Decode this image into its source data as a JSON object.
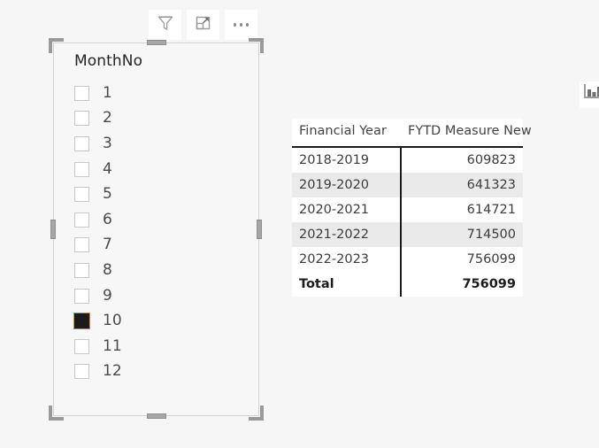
{
  "toolbar": {
    "items": [
      {
        "name": "filter-icon",
        "label": "Filters"
      },
      {
        "name": "focus-mode-icon",
        "label": "Focus mode"
      },
      {
        "name": "more-options-icon",
        "label": "More options"
      }
    ]
  },
  "slicer": {
    "title": "MonthNo",
    "items": [
      {
        "label": "1",
        "checked": false
      },
      {
        "label": "2",
        "checked": false
      },
      {
        "label": "3",
        "checked": false
      },
      {
        "label": "4",
        "checked": false
      },
      {
        "label": "5",
        "checked": false
      },
      {
        "label": "6",
        "checked": false
      },
      {
        "label": "7",
        "checked": false
      },
      {
        "label": "8",
        "checked": false
      },
      {
        "label": "9",
        "checked": false
      },
      {
        "label": "10",
        "checked": true
      },
      {
        "label": "11",
        "checked": false
      },
      {
        "label": "12",
        "checked": false
      }
    ]
  },
  "chart_data": {
    "type": "table",
    "title": "",
    "columns": [
      "Financial Year",
      "FYTD Measure New"
    ],
    "categories": [
      "2018-2019",
      "2019-2020",
      "2020-2021",
      "2021-2022",
      "2022-2023"
    ],
    "values": [
      609823,
      641323,
      614721,
      714500,
      756099
    ],
    "rows": [
      {
        "cells": [
          "2018-2019",
          "609823"
        ],
        "band": false,
        "total": false
      },
      {
        "cells": [
          "2019-2020",
          "641323"
        ],
        "band": true,
        "total": false
      },
      {
        "cells": [
          "2020-2021",
          "614721"
        ],
        "band": false,
        "total": false
      },
      {
        "cells": [
          "2021-2022",
          "714500"
        ],
        "band": true,
        "total": false
      },
      {
        "cells": [
          "2022-2023",
          "756099"
        ],
        "band": false,
        "total": false
      },
      {
        "cells": [
          "Total",
          "756099"
        ],
        "band": false,
        "total": true
      }
    ],
    "total_label": "Total",
    "total_value": "756099",
    "xlabel": "Financial Year",
    "ylabel": "FYTD Measure New"
  },
  "edge_panel": {
    "icon": "bar-chart-icon"
  },
  "colors": {
    "page_background": "#f6f6f6",
    "visual_background": "#ffffff",
    "band_row": "#eaeaea",
    "rule": "#1b1b1b",
    "selection_handle": "#a6a6a6",
    "checkbox_checked": "#1b1b1b"
  }
}
